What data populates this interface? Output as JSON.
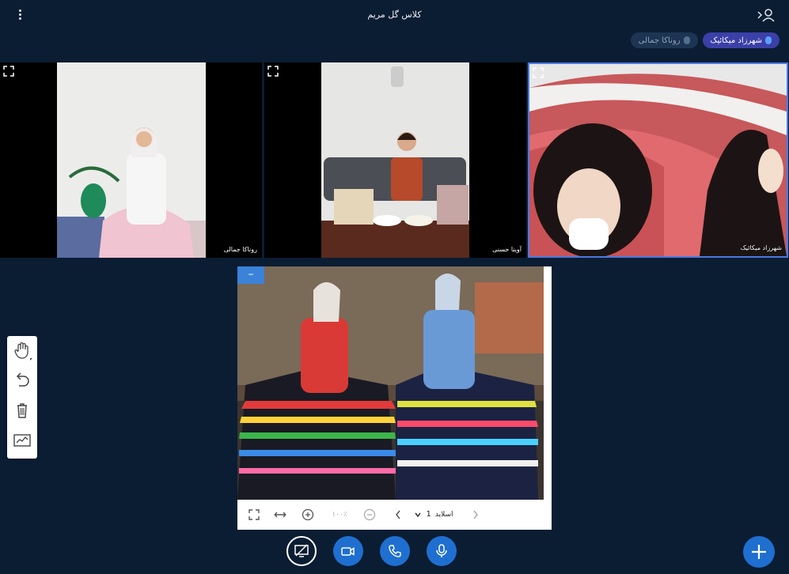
{
  "header": {
    "title": "کلاس گل مریم"
  },
  "presence": [
    {
      "name": "شهرزاد میکائیک",
      "state": "talking"
    },
    {
      "name": "روناکا جمالی",
      "state": "muted"
    }
  ],
  "videos": [
    {
      "name": "روناکا جمالی"
    },
    {
      "name": "آوینا حسنی"
    },
    {
      "name": "شهرزاد میکائیک"
    }
  ],
  "presentation": {
    "minimize_label": "–",
    "slide_label": "اسلاید",
    "slide_number": "1",
    "zoom_value": "۱۰۰٪"
  },
  "icons": {
    "menu": "kebab-menu-icon",
    "users": "users-icon",
    "expand": "expand-icon",
    "hand": "hand-tool-icon",
    "undo": "undo-icon",
    "delete": "trash-icon",
    "whiteboard": "whiteboard-icon",
    "screen": "screen-share-icon",
    "camera": "camera-icon",
    "phone": "phone-icon",
    "mic": "microphone-icon",
    "plus": "plus-icon"
  },
  "colors": {
    "background": "#0b1d33",
    "accent": "#1f6fd0",
    "active_pill": "#3b3fa8"
  }
}
